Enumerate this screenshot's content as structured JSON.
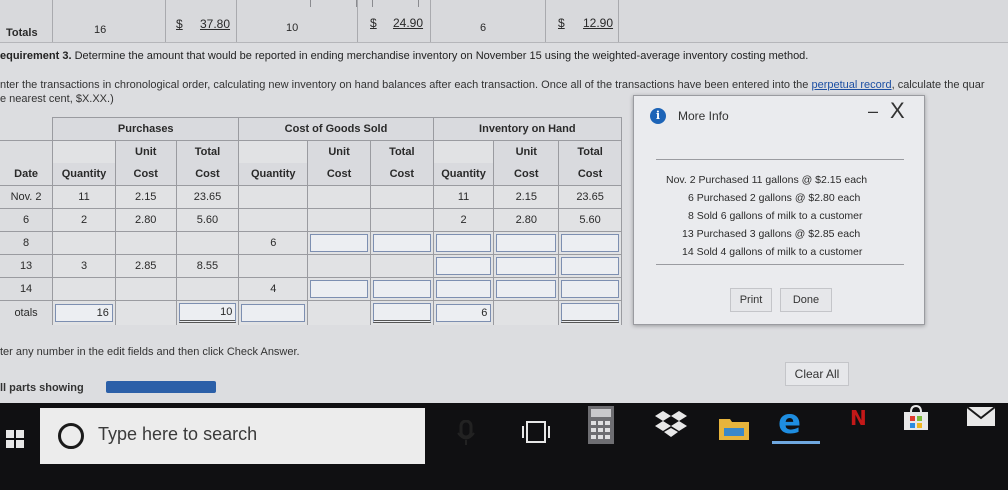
{
  "top_totals": {
    "label": "Totals",
    "purchases_qty": "16",
    "purchases_total_currency": "$",
    "purchases_total": "37.80",
    "cogs_qty": "10",
    "cogs_total_currency": "$",
    "cogs_total": "24.90",
    "inventory_qty": "6",
    "inventory_total_currency": "$",
    "inventory_total": "12.90"
  },
  "requirement": {
    "label": "equirement 3.",
    "text": "Determine the amount that would be reported in ending merchandise inventory on November 15 using the weighted-average inventory costing method."
  },
  "instructions": {
    "line1": "nter the transactions in chronological order, calculating new inventory on hand balances after each transaction. Once all of the transactions have been entered into the",
    "link": "perpetual record",
    "line1_tail": ", calculate the quar",
    "line2": "e nearest cent, $X.XX.)"
  },
  "table": {
    "group_headers": {
      "purchases": "Purchases",
      "cogs": "Cost of Goods Sold",
      "inventory": "Inventory on Hand"
    },
    "col_headers": {
      "date": "Date",
      "quantity": "Quantity",
      "unit": "Unit",
      "cost": "Cost",
      "total": "Total"
    },
    "rows": [
      {
        "date": "Nov. 2",
        "p_qty": "11",
        "p_unit": "2.15",
        "p_total": "23.65",
        "c_qty": "",
        "c_unit": "",
        "c_total": "",
        "i_qty": "11",
        "i_unit": "2.15",
        "i_total": "23.65"
      },
      {
        "date": "6",
        "p_qty": "2",
        "p_unit": "2.80",
        "p_total": "5.60",
        "c_qty": "",
        "c_unit": "",
        "c_total": "",
        "i_qty": "2",
        "i_unit": "2.80",
        "i_total": "5.60"
      },
      {
        "date": "8",
        "p_qty": "",
        "p_unit": "",
        "p_total": "",
        "c_qty": "6",
        "c_unit": "",
        "c_total": "",
        "i_qty": "",
        "i_unit": "",
        "i_total": ""
      },
      {
        "date": "13",
        "p_qty": "3",
        "p_unit": "2.85",
        "p_total": "8.55",
        "c_qty": "",
        "c_unit": "",
        "c_total": "",
        "i_qty": "",
        "i_unit": "",
        "i_total": ""
      },
      {
        "date": "14",
        "p_qty": "",
        "p_unit": "",
        "p_total": "",
        "c_qty": "4",
        "c_unit": "",
        "c_total": "",
        "i_qty": "",
        "i_unit": "",
        "i_total": ""
      }
    ],
    "totals": {
      "label": "otals",
      "p_qty": "16",
      "p_total": "10",
      "i_qty": "6"
    }
  },
  "modal": {
    "title": "More Info",
    "minimize": "–",
    "close": "X",
    "lines": [
      "Nov. 2 Purchased 11 gallons @ $2.15 each",
      "6 Purchased 2 gallons @ $2.80 each",
      "8 Sold 6 gallons of milk to a customer",
      "13 Purchased 3 gallons @ $2.85 each",
      "14 Sold 4 gallons of milk to a customer"
    ],
    "print_label": "Print",
    "done_label": "Done"
  },
  "footer": {
    "hint": "ter any number in the edit fields and then click Check Answer.",
    "clear_all": "Clear All",
    "parts_showing": "ll parts showing"
  },
  "taskbar": {
    "search_placeholder": "Type here to search",
    "icons": [
      "windows-logo",
      "search-circle",
      "microphone",
      "task-view",
      "calculator",
      "dropbox",
      "file-explorer",
      "edge",
      "netflix",
      "store",
      "mail"
    ]
  },
  "colors": {
    "accent": "#2b5fa8",
    "info_icon": "#1d64b7",
    "taskbar": "#101012",
    "edge": "#1e8de0",
    "netflix": "#c31818"
  }
}
